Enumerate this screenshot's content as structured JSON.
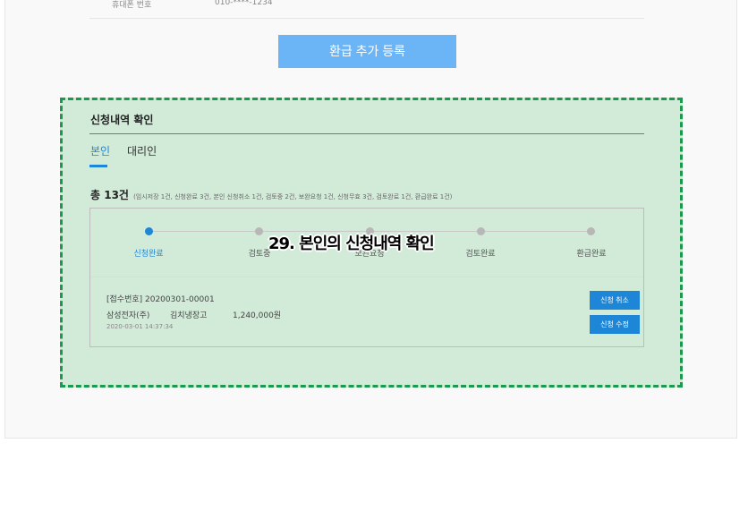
{
  "phone": {
    "label": "휴대폰 번호",
    "value": "010-****-1234"
  },
  "add_button": "환급 추가 등록",
  "section": {
    "title": "신청내역 확인"
  },
  "tabs": [
    {
      "label": "본인"
    },
    {
      "label": "대리인"
    }
  ],
  "summary": {
    "total": "총 13건",
    "detail": "(임시저장 1건, 신청완료 3건, 본인 신청취소 1건, 검토중 2건, 보완요청 1건, 신청무효 3건, 검토완료 1건, 환급완료 1건)"
  },
  "steps": [
    {
      "label": "신청완료",
      "active": true
    },
    {
      "label": "검토중",
      "active": false
    },
    {
      "label": "보완요청",
      "active": false
    },
    {
      "label": "검토완료",
      "active": false
    },
    {
      "label": "환급완료",
      "active": false
    }
  ],
  "application": {
    "receipt": "[접수번호] 20200301-00001",
    "manufacturer": "삼성전자(주)",
    "product": "김치냉장고",
    "amount": "1,240,000원",
    "datetime": "2020-03-01 14:37:34"
  },
  "actions": {
    "cancel": "신청 취소",
    "edit": "신청 수정"
  },
  "caption": "29. 본인의 신청내역 확인",
  "colors": {
    "accent": "#1d86d6",
    "highlight_border": "#1a9a4c",
    "button_light": "#6bb5f7"
  }
}
